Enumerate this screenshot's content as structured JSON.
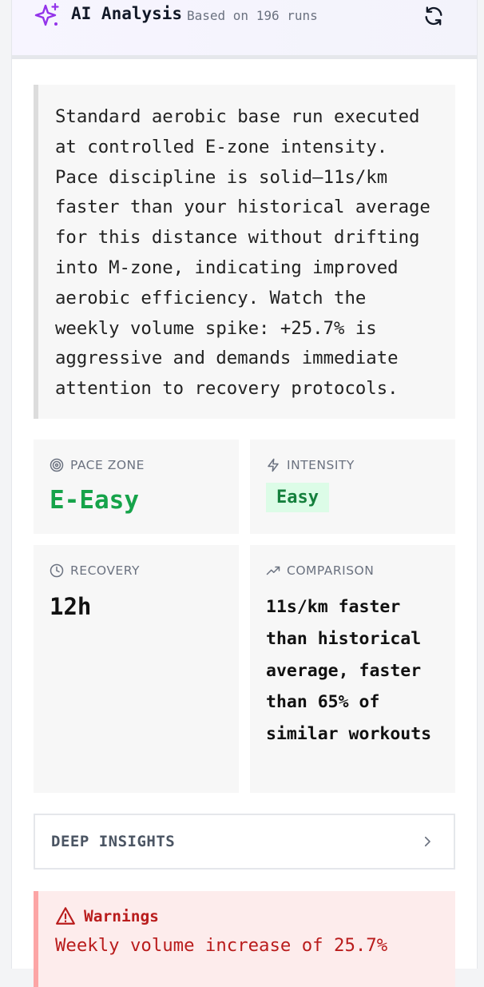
{
  "header": {
    "title": "AI Analysis",
    "subtitle": "Based on 196 runs",
    "icons": {
      "title": "sparkle-icon",
      "refresh": "refresh-icon"
    },
    "accent_color": "#9333ea"
  },
  "summary": {
    "text": "Standard aerobic base run executed at controlled E-zone intensity. Pace discipline is solid—11s/km faster than your historical average for this distance without drifting into M-zone, indicating improved aerobic efficiency. Watch the weekly volume spike: +25.7% is aggressive and demands immediate attention to recovery protocols."
  },
  "metrics": {
    "pace_zone": {
      "label": "PACE ZONE",
      "value": "E-Easy",
      "icon": "target-icon",
      "color": "#16a34a"
    },
    "intensity": {
      "label": "INTENSITY",
      "value": "Easy",
      "icon": "lightning-icon",
      "badge_bg": "#dcfce7",
      "badge_color": "#15803d"
    },
    "recovery": {
      "label": "RECOVERY",
      "value": "12h",
      "icon": "clock-icon"
    },
    "comparison": {
      "label": "COMPARISON",
      "value": "11s/km faster than historical average, faster than 65% of similar workouts",
      "icon": "trending-up-icon"
    }
  },
  "deep_insights": {
    "label": "DEEP INSIGHTS",
    "icon": "chevron-right-icon"
  },
  "warnings": {
    "title": "Warnings",
    "icon": "alert-triangle-icon",
    "text": "Weekly volume increase of 25.7%",
    "color": "#b91c1c"
  }
}
